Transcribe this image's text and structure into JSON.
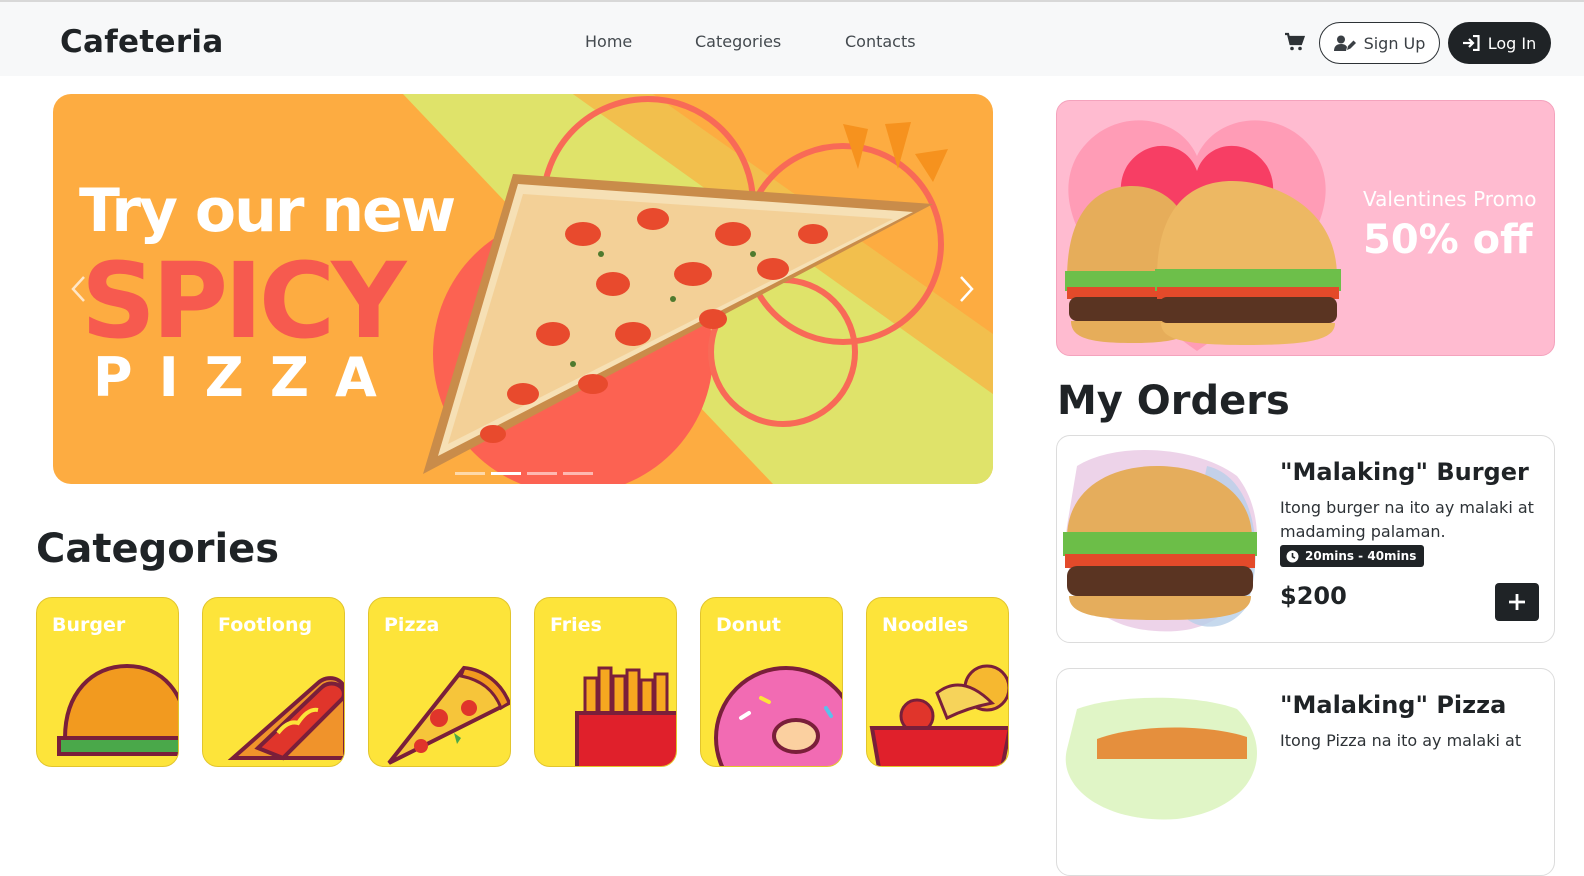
{
  "navbar": {
    "brand": "Cafeteria",
    "links": [
      "Home",
      "Categories",
      "Contacts"
    ],
    "signup_label": "Sign Up",
    "login_label": "Log In",
    "icons": {
      "cart": "cart-icon",
      "signup": "user-pen-icon",
      "login": "sign-in-icon"
    }
  },
  "hero": {
    "line1": "Try our new",
    "line2": "SPICY",
    "line3": "PIZZA",
    "slide_count": 4,
    "active_slide": 2,
    "colors": {
      "background": "#fdac41",
      "accent": "#f65a4f",
      "stripe": "#dfe36a"
    }
  },
  "categories": {
    "heading": "Categories",
    "items": [
      {
        "label": "Burger",
        "icon": "burger-icon"
      },
      {
        "label": "Footlong",
        "icon": "hotdog-icon"
      },
      {
        "label": "Pizza",
        "icon": "pizza-icon"
      },
      {
        "label": "Fries",
        "icon": "fries-icon"
      },
      {
        "label": "Donut",
        "icon": "donut-icon"
      },
      {
        "label": "Noodles",
        "icon": "noodles-icon"
      }
    ],
    "card_color": "#fde43a"
  },
  "promo": {
    "subtitle": "Valentines Promo",
    "headline": "50% off",
    "color": "#ffbbd0"
  },
  "orders": {
    "heading": "My Orders",
    "items": [
      {
        "title": "\"Malaking\" Burger",
        "description": "Itong burger na ito ay malaki at madaming palaman.",
        "time": "20mins - 40mins",
        "price": "$200"
      },
      {
        "title": "\"Malaking\" Pizza",
        "description": "Itong Pizza na ito ay malaki at"
      }
    ]
  }
}
